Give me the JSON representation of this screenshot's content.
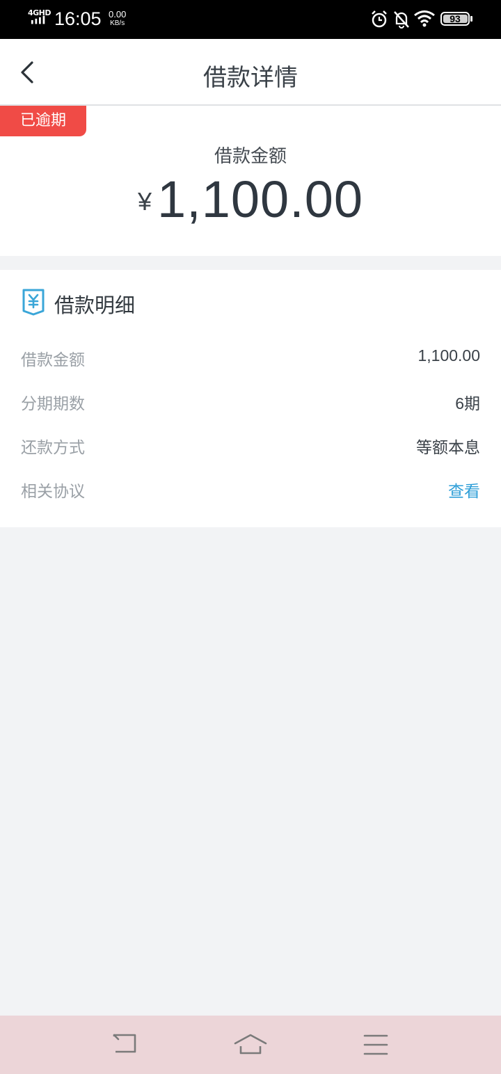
{
  "status_bar": {
    "network": "4GHD",
    "time": "16:05",
    "speed_value": "0.00",
    "speed_unit": "KB/s",
    "battery": "93",
    "icons": [
      "alarm-icon",
      "bell-muted-icon",
      "wifi-icon",
      "battery-icon"
    ]
  },
  "header": {
    "title": "借款详情",
    "back_icon": "chevron-left-icon"
  },
  "summary": {
    "status_badge": "已逾期",
    "amount_label": "借款金额",
    "currency_symbol": "¥",
    "amount": "1,100.00"
  },
  "details": {
    "title": "借款明细",
    "icon": "yuan-bill-icon",
    "rows": [
      {
        "label": "借款金额",
        "value": "1,100.00"
      },
      {
        "label": "分期期数",
        "value": "6期"
      },
      {
        "label": "还款方式",
        "value": "等额本息"
      },
      {
        "label": "相关协议",
        "value": "查看"
      }
    ]
  },
  "system_nav": {
    "buttons": [
      "back-nav-icon",
      "home-nav-icon",
      "menu-nav-icon"
    ]
  },
  "colors": {
    "overdue": "#f04b46",
    "link": "#2f9fd8",
    "icon_accent": "#3aa6d8",
    "background": "#f2f3f5",
    "system_nav_bg": "#ecd5d8"
  }
}
